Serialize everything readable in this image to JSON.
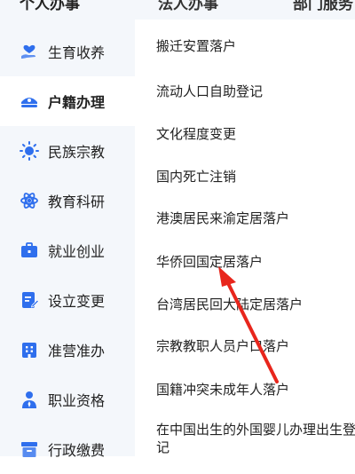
{
  "top_tabs": [
    "个人办事",
    "法人办事",
    "部门服务"
  ],
  "sidebar": {
    "items": [
      {
        "label": "生育收养",
        "icon": "family-icon"
      },
      {
        "label": "户籍办理",
        "icon": "police-cap-icon",
        "active": true
      },
      {
        "label": "民族宗教",
        "icon": "sun-icon"
      },
      {
        "label": "教育科研",
        "icon": "atom-icon"
      },
      {
        "label": "就业创业",
        "icon": "briefcase-icon"
      },
      {
        "label": "设立变更",
        "icon": "edit-document-icon"
      },
      {
        "label": "准营准办",
        "icon": "building-icon"
      },
      {
        "label": "职业资格",
        "icon": "person-badge-icon"
      },
      {
        "label": "行政缴费",
        "icon": "box-icon"
      }
    ]
  },
  "content": {
    "items": [
      "搬迁安置落户",
      "流动人口自助登记",
      "文化程度变更",
      "国内死亡注销",
      "港澳居民来渝定居落户",
      "华侨回国定居落户",
      "台湾居民回大陆定居落户",
      "宗教教职人员户口落户",
      "国籍冲突未成年人落户",
      "在中国出生的外国婴儿办理出生登记"
    ]
  },
  "colors": {
    "accent": "#2f6fed",
    "sidebar_bg": "#f4f7fb",
    "annotation_arrow": "#e8261c"
  }
}
